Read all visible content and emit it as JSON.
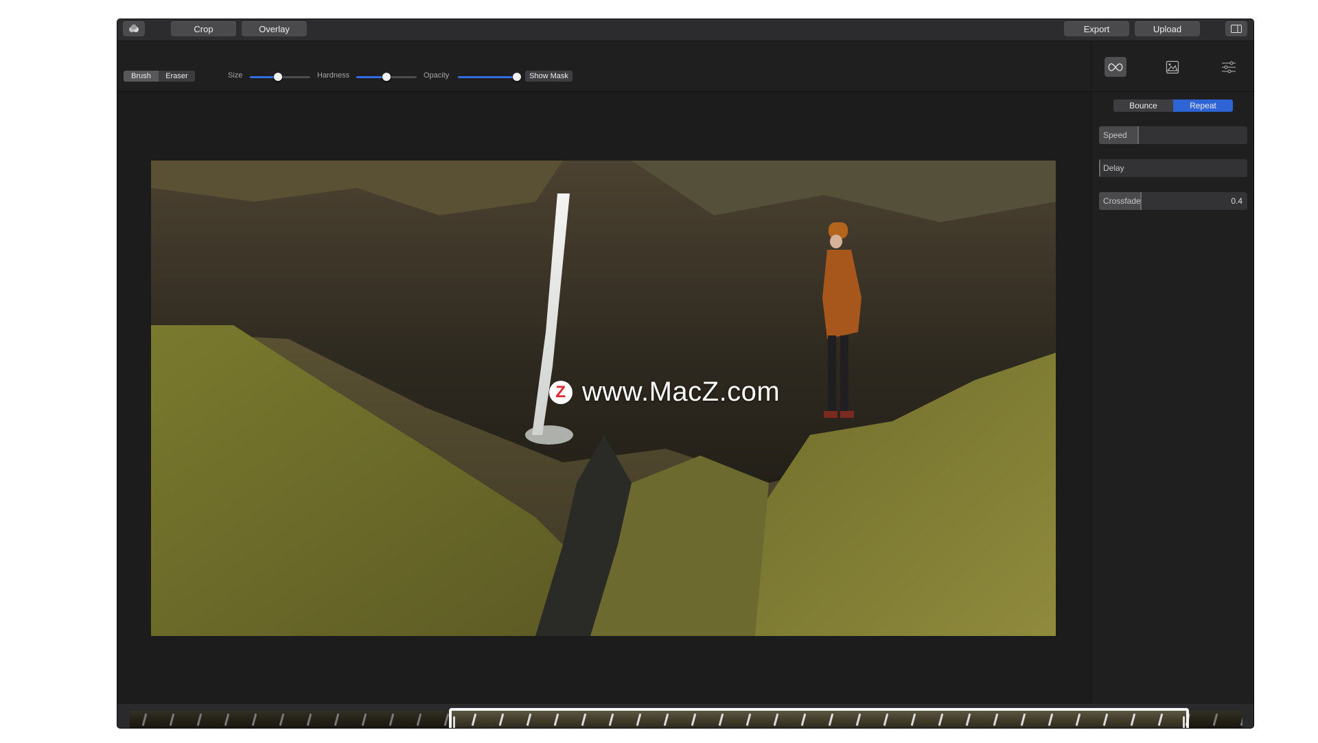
{
  "titlebar": {
    "crop_label": "Crop",
    "overlay_label": "Overlay",
    "export_label": "Export",
    "upload_label": "Upload"
  },
  "toolbar": {
    "brush_label": "Brush",
    "eraser_label": "Eraser",
    "size_label": "Size",
    "hardness_label": "Hardness",
    "opacity_label": "Opacity",
    "show_mask_label": "Show Mask",
    "size_value": 0.47,
    "hardness_value": 0.5,
    "opacity_value": 1.0
  },
  "canvas": {
    "watermark_text": "www.MacZ.com",
    "watermark_logo": "Z"
  },
  "panel": {
    "tabs": [
      {
        "icon": "loop-icon",
        "active": true
      },
      {
        "icon": "image-icon",
        "active": false
      },
      {
        "icon": "sliders-icon",
        "active": false
      }
    ],
    "bounce_label": "Bounce",
    "repeat_label": "Repeat",
    "speed_label": "Speed",
    "speed_value": 0.26,
    "delay_label": "Delay",
    "delay_value": 0.0,
    "crossfade_label": "Crossfade",
    "crossfade_value_text": "0.4",
    "crossfade_value": 0.28
  },
  "colors": {
    "accent": "#2f6de0",
    "window_bg": "#1c1c1d"
  }
}
